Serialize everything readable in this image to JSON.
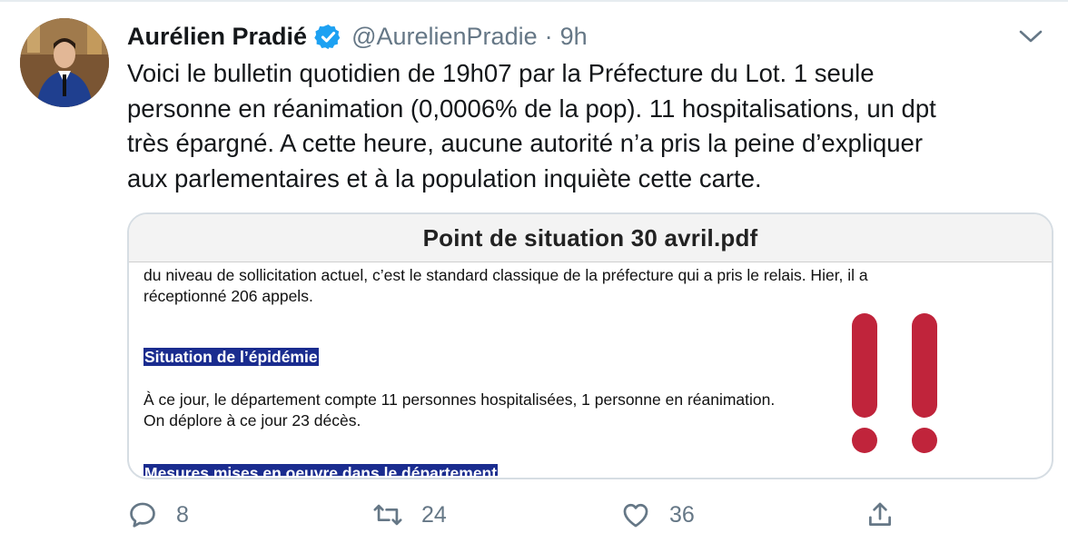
{
  "tweet": {
    "author_name": "Aurélien Pradié",
    "handle": "@AurelienPradie",
    "separator": "·",
    "time": "9h",
    "text_lines": [
      "Voici le bulletin quotidien de 19h07 par la Préfecture du Lot. 1 seule",
      "personne en réanimation (0,0006% de la pop). 11 hospitalisations, un dpt",
      "très épargné. A cette heure, aucune autorité n’a pris la peine d’expliquer",
      "aux parlementaires et à la population inquiète cette carte."
    ]
  },
  "card": {
    "title": "Point de situation 30 avril.pdf",
    "doc_lines": {
      "line1": "du niveau de sollicitation actuel, c’est le standard classique de la préfecture qui a pris le relais. Hier, il a",
      "line2": "réceptionné 206 appels.",
      "heading1": "Situation de l’épidémie",
      "line3": "À ce jour, le département compte 11 personnes hospitalisées, 1 personne en réanimation.",
      "line4": "On déplore à ce jour 23 décès.",
      "heading2": "Mesures mises en oeuvre dans le département"
    }
  },
  "actions": {
    "replies": "8",
    "retweets": "24",
    "likes": "36"
  },
  "colors": {
    "verified": "#1da1f2",
    "muted": "#657786",
    "exclamation": "#c0243b",
    "highlight": "#1a2c8f"
  }
}
